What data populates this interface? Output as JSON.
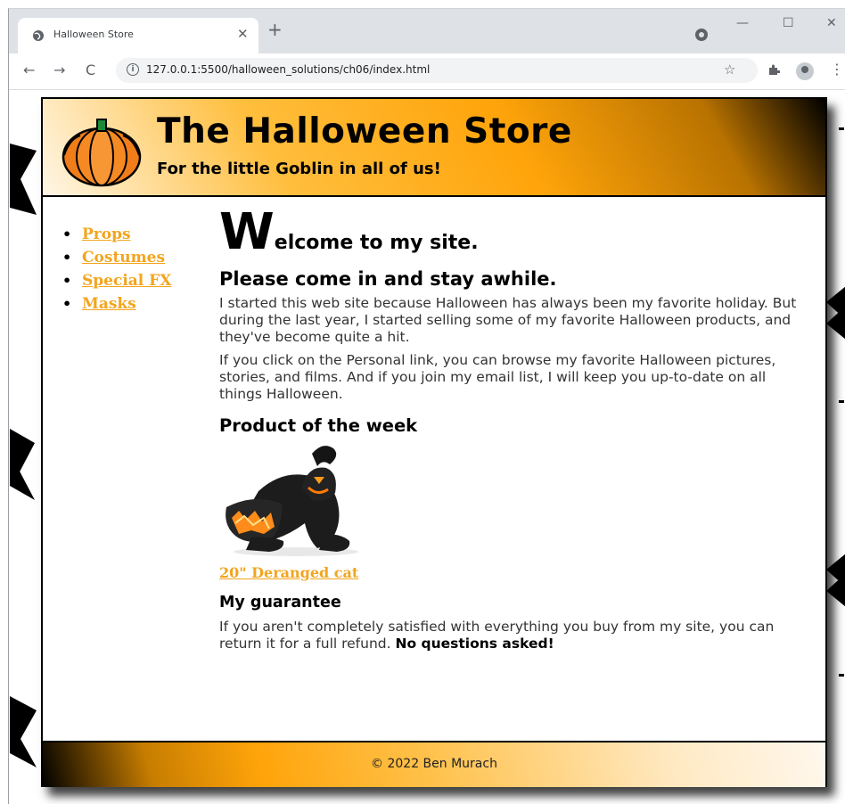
{
  "browser": {
    "tab_title": "Halloween Store",
    "url": "127.0.0.1:5500/halloween_solutions/ch06/index.html"
  },
  "header": {
    "title": "The Halloween Store",
    "subtitle": "For the little Goblin in all of us!"
  },
  "nav": {
    "items": [
      "Props",
      "Costumes",
      "Special FX",
      "Masks"
    ]
  },
  "main": {
    "welcome_cap": "W",
    "welcome_rest": "elcome to my site.",
    "subheading": "Please come in and stay awhile.",
    "para1": "I started this web site because Halloween has always been my favorite holiday. But during the last year, I started selling some of my favorite Halloween products, and they've become quite a hit.",
    "para2": "If you click on the Personal link, you can browse my favorite Halloween pictures, stories, and films. And if you join my email list, I will keep you up-to-date on all things Halloween.",
    "product_heading": "Product of the week",
    "product_link": "20\" Deranged cat",
    "guarantee_heading": "My guarantee",
    "guarantee_text": "If you aren't completely satisfied with everything you buy from my site, you can return it for a full refund.",
    "guarantee_strong": "No questions asked!"
  },
  "footer": {
    "text": "© 2022 Ben Murach"
  },
  "colors": {
    "link": "#f2a51f",
    "accent": "#ffa40a"
  }
}
